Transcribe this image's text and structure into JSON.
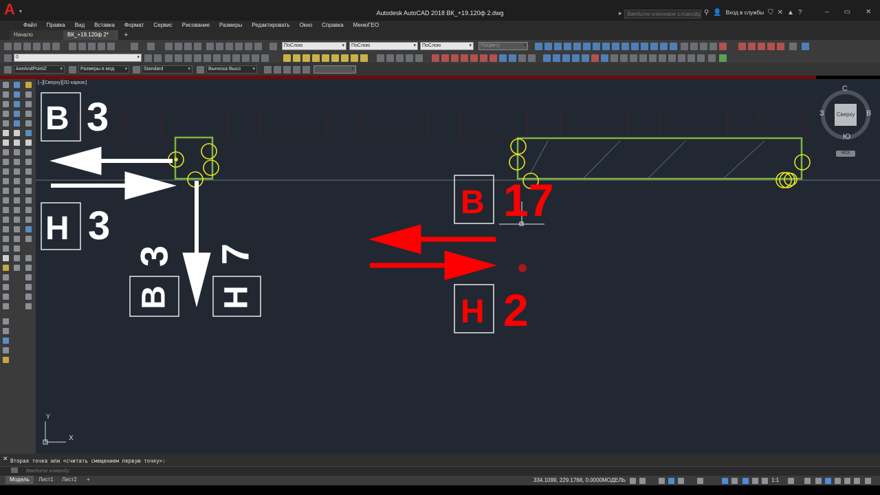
{
  "app": {
    "title": "Autodesk AutoCAD 2018   ВК_+19.120ф 2.dwg",
    "logo": "A",
    "search_placeholder": "Введите ключевое слово/фразу",
    "login": "Вход в службы"
  },
  "menu": [
    "Файл",
    "Правка",
    "Вид",
    "Вставка",
    "Формат",
    "Сервис",
    "Рисование",
    "Размеры",
    "Редактировать",
    "Окно",
    "Справка",
    "МенюГЕО"
  ],
  "tabs": {
    "start": "Начало",
    "doc": "ВК_+19.120ф 2*",
    "add": "+"
  },
  "toolbars": {
    "layer_value": "0",
    "color": "ПоСлою",
    "linetype": "ПоСлою",
    "lineweight": "ПоСлою",
    "plotstyle": "ПоЦвету",
    "text_style": "AxeAndPointZ",
    "dim_style": "Размеры в мод",
    "table_style": "Standard",
    "mleader_style": "Выноска Высо"
  },
  "viewport": {
    "label": "[–][Сверху][2D каркас]"
  },
  "annotations": {
    "white": {
      "top_left_letter": "В",
      "top_left_num": "3",
      "bot_left_letter": "Н",
      "bot_left_num": "3",
      "rot_b_letter": "В",
      "rot_b_num": "3",
      "rot_h_letter": "Н",
      "rot_h_num": "7"
    },
    "red": {
      "top_letter": "В",
      "top_num": "17",
      "bot_letter": "Н",
      "bot_num": "2"
    }
  },
  "viewcube": {
    "north": "С",
    "south": "Ю",
    "west": "З",
    "east": "В",
    "face": "Сверху",
    "wcs": "МСК"
  },
  "ucs": {
    "x": "X",
    "y": "Y"
  },
  "command": {
    "history": "Вторая точка или <считать смещением первую точку>:",
    "placeholder": "Введите команду"
  },
  "layout_tabs": [
    "Модель",
    "Лист1",
    "Лист2",
    "+"
  ],
  "status": {
    "coords": "334.1099, 229.1768, 0.0000",
    "model": "МОДЕЛЬ",
    "scale": "1:1"
  },
  "colors": {
    "canvas_bg": "#212832",
    "pipe_green": "#7cb342",
    "marker_yellow": "#e6e619",
    "arrow_red": "#ff0000",
    "arrow_white": "#ffffff"
  }
}
